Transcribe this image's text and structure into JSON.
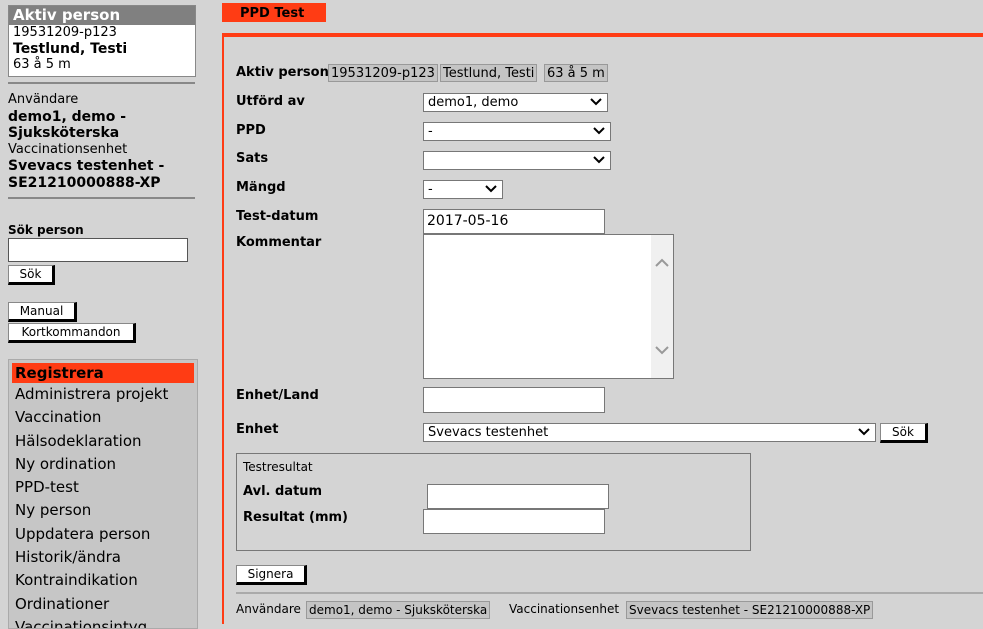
{
  "sidebar": {
    "active_person": {
      "heading": "Aktiv person",
      "personnummer": "19531209-p123",
      "name": "Testlund, Testi",
      "age": "63 å 5 m"
    },
    "user": {
      "label": "Användare",
      "value": "demo1, demo - Sjuksköterska"
    },
    "unit": {
      "label": "Vaccinationsenhet",
      "value": "Svevacs testenhet - SE21210000888-XP"
    },
    "search": {
      "label": "Sök person",
      "value": "",
      "button": "Sök"
    },
    "manual_button": "Manual",
    "shortcuts_button": "Kortkommandon",
    "menu": {
      "heading": "Registrera",
      "items": [
        "Administrera projekt",
        "Vaccination",
        "Hälsodeklaration",
        "Ny ordination",
        "PPD-test",
        "Ny person",
        "Uppdatera person",
        "Historik/ändra",
        "Kontraindikation",
        "Ordinationer",
        "Vaccinationsintyg"
      ]
    }
  },
  "main": {
    "tab_label": "PPD Test",
    "form": {
      "active_person_label": "Aktiv person",
      "active_person_chips": [
        "19531209-p123",
        "Testlund, Testi",
        "63 å 5 m"
      ],
      "performed_by_label": "Utförd av",
      "performed_by_value": "demo1, demo",
      "ppd_label": "PPD",
      "ppd_value": "-",
      "batch_label": "Sats",
      "batch_value": "",
      "amount_label": "Mängd",
      "amount_value": "-",
      "test_date_label": "Test-datum",
      "test_date_value": "2017-05-16",
      "comment_label": "Kommentar",
      "comment_value": "",
      "unit_country_label": "Enhet/Land",
      "unit_country_value": "",
      "unit_label": "Enhet",
      "unit_value": "Svevacs testenhet",
      "unit_search_button": "Sök",
      "result": {
        "legend": "Testresultat",
        "read_date_label": "Avl. datum",
        "read_date_value": "",
        "result_label": "Resultat (mm)",
        "result_value": ""
      },
      "sign_button": "Signera"
    },
    "footer": {
      "user_label": "Användare",
      "user_value": "demo1, demo - Sjuksköterska",
      "unit_label": "Vaccinationsenhet",
      "unit_value": "Svevacs testenhet - SE21210000888-XP"
    }
  },
  "icons": {
    "select_arrow": "chevron-down-icon",
    "scroll_up": "chevron-up-icon",
    "scroll_down": "chevron-down-icon"
  },
  "colors": {
    "accent": "#ff3c14",
    "background": "#d4d4d4",
    "header_gray": "#808080"
  }
}
